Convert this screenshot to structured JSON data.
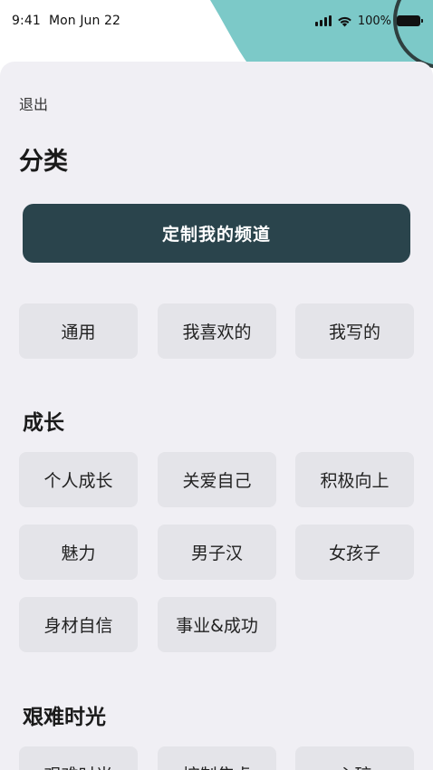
{
  "status_bar": {
    "time": "9:41",
    "date": "Mon Jun 22",
    "battery": "100%"
  },
  "colors": {
    "accent_blob": "#7cc9c8",
    "sheet_bg": "#f0eff4",
    "cta_bg": "#2a444c",
    "chip_bg": "#e4e4e9"
  },
  "header": {
    "exit_label": "退出",
    "title": "分类"
  },
  "cta": {
    "label": "定制我的频道"
  },
  "top_chips": [
    "通用",
    "我喜欢的",
    "我写的"
  ],
  "sections": [
    {
      "title": "成长",
      "chips": [
        "个人成长",
        "关爱自己",
        "积极向上",
        "魅力",
        "男子汉",
        "女孩子",
        "身材自信",
        "事业&成功"
      ]
    },
    {
      "title": "艰难时光",
      "chips": [
        "艰难时光",
        "控制焦虑",
        "心碎"
      ]
    }
  ]
}
